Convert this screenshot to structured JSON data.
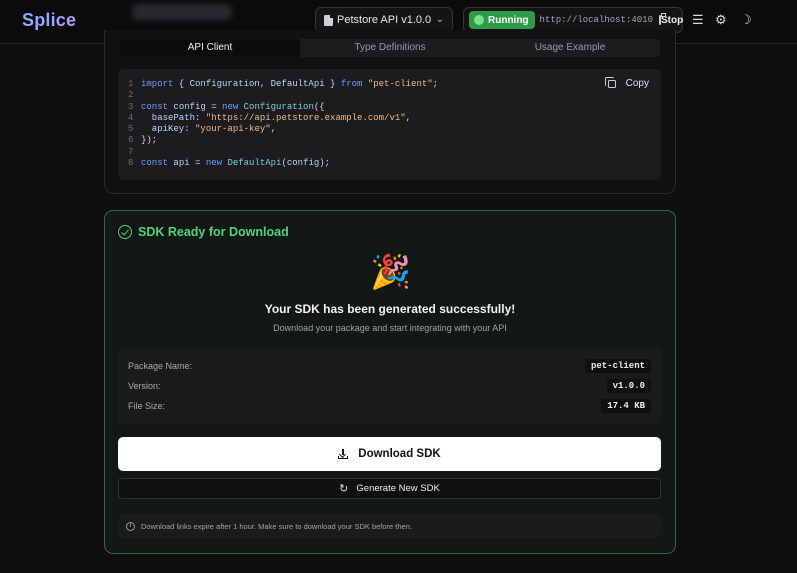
{
  "app": {
    "name": "Splice"
  },
  "header": {
    "api_select": {
      "value": "Petstore API v1.0.0"
    },
    "server": {
      "status": "Running",
      "url": "http://localhost:4010",
      "stop_label": "Stop"
    },
    "icons": [
      "menu-icon",
      "gear-icon",
      "moon-icon"
    ]
  },
  "code_panel": {
    "tabs": [
      {
        "label": "API Client",
        "active": true
      },
      {
        "label": "Type Definitions",
        "active": false
      },
      {
        "label": "Usage Example",
        "active": false
      }
    ],
    "copy_label": "Copy",
    "line_numbers": [
      "1",
      "2",
      "3",
      "4",
      "5",
      "6",
      "7",
      "8"
    ],
    "code": {
      "l1_import": "import",
      "l1_names": " { Configuration, DefaultApi } ",
      "l1_from": "from",
      "l1_module": " \"pet-client\"",
      "l1_end": ";",
      "l3_const": "const",
      "l3_var": " config ",
      "l3_eq": "= ",
      "l3_new": "new",
      "l3_class": " Configuration",
      "l3_open": "({",
      "l4_key": "  basePath",
      "l4_colon": ": ",
      "l4_val": "\"https://api.petstore.example.com/v1\"",
      "l4_comma": ",",
      "l5_key": "  apiKey",
      "l5_colon": ": ",
      "l5_val": "\"your-api-key\"",
      "l5_comma": ",",
      "l6_close": "});",
      "l8_const": "const",
      "l8_var": " api ",
      "l8_eq": "= ",
      "l8_new": "new",
      "l8_class": " DefaultApi",
      "l8_args_open": "(",
      "l8_arg": "config",
      "l8_args_close": ");"
    }
  },
  "sdk": {
    "title": "SDK Ready for Download",
    "emoji": "🎉",
    "success_title": "Your SDK has been generated successfully!",
    "success_subtitle": "Download your package and start integrating with your API",
    "details": {
      "package_name_label": "Package Name:",
      "package_name_value": "pet-client",
      "version_label": "Version:",
      "version_value": "v1.0.0",
      "file_size_label": "File Size:",
      "file_size_value": "17.4 KB"
    },
    "download_label": "Download SDK",
    "regenerate_label": "Generate New SDK",
    "notice": "Download links expire after 1 hour. Make sure to download your SDK before then."
  },
  "colors": {
    "accent_green": "#4ccf74",
    "running_green": "#2f9a48",
    "logo_gradient_start": "#7fb1ff",
    "logo_gradient_end": "#b79cff"
  }
}
